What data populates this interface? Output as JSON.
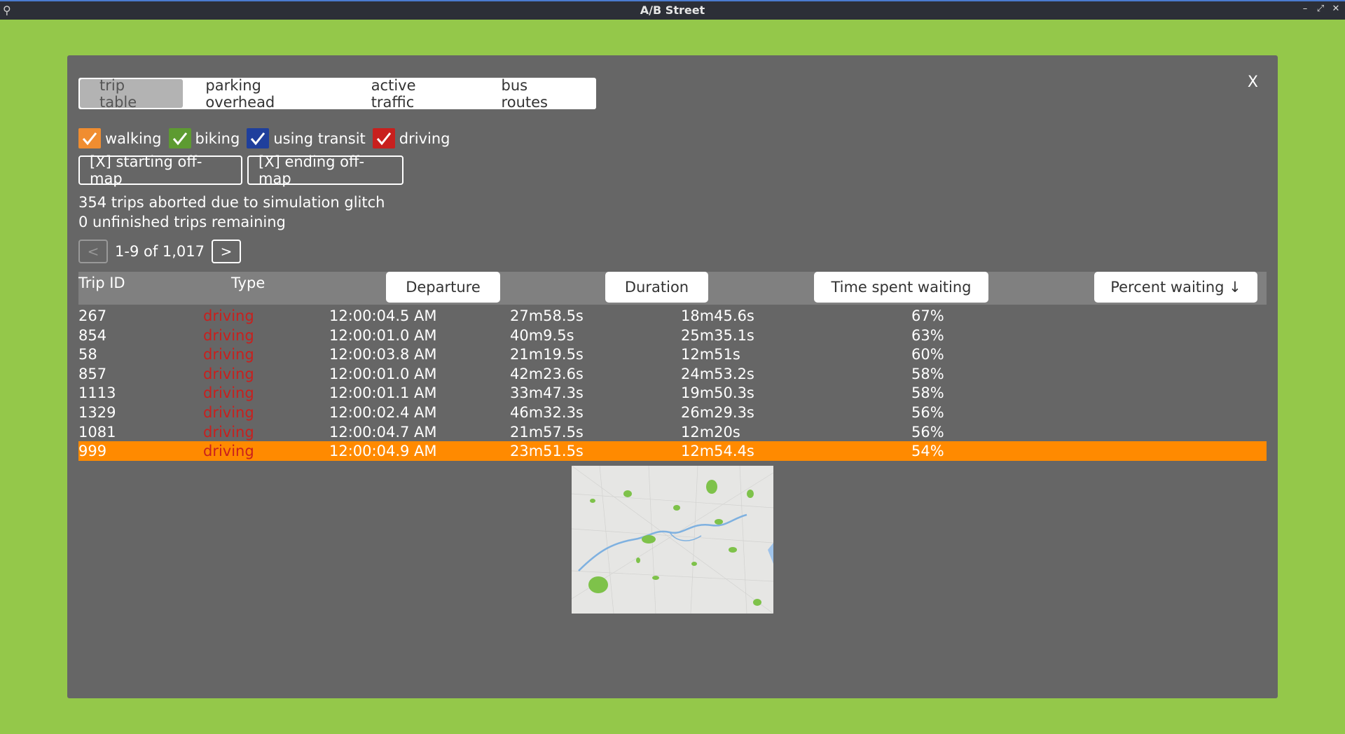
{
  "window": {
    "title": "A/B Street",
    "minimize_glyph": "–",
    "maximize_glyph": "⤢",
    "close_glyph": "✕",
    "app_icon": "bike-icon"
  },
  "panel": {
    "close_label": "X"
  },
  "tabs": [
    {
      "label": "trip table",
      "active": true
    },
    {
      "label": "parking overhead",
      "active": false
    },
    {
      "label": "active traffic",
      "active": false
    },
    {
      "label": "bus routes",
      "active": false
    }
  ],
  "filters": [
    {
      "label": "walking",
      "checked": true,
      "color": "#f08d30"
    },
    {
      "label": "biking",
      "checked": true,
      "color": "#5d9b31"
    },
    {
      "label": "using transit",
      "checked": true,
      "color": "#1f3f9c"
    },
    {
      "label": "driving",
      "checked": true,
      "color": "#c8201e"
    }
  ],
  "buttons": {
    "starting_offmap": "[X] starting off-map",
    "ending_offmap": "[X] ending off-map"
  },
  "status": {
    "aborted": "354 trips aborted due to simulation glitch",
    "unfinished": "0 unfinished trips remaining"
  },
  "pagination": {
    "prev": "<",
    "range": "1-9 of 1,017",
    "next": ">"
  },
  "table": {
    "columns": [
      "Trip ID",
      "Type",
      "Departure",
      "Duration",
      "Time spent waiting",
      "Percent waiting ↓"
    ],
    "rows": [
      [
        "267",
        "driving",
        "12:00:04.5 AM",
        "27m58.5s",
        "18m45.6s",
        "67%"
      ],
      [
        "854",
        "driving",
        "12:00:01.0 AM",
        "40m9.5s",
        "25m35.1s",
        "63%"
      ],
      [
        "58",
        "driving",
        "12:00:03.8 AM",
        "21m19.5s",
        "12m51s",
        "60%"
      ],
      [
        "857",
        "driving",
        "12:00:01.0 AM",
        "42m23.6s",
        "24m53.2s",
        "58%"
      ],
      [
        "1113",
        "driving",
        "12:00:01.1 AM",
        "33m47.3s",
        "19m50.3s",
        "58%"
      ],
      [
        "1329",
        "driving",
        "12:00:02.4 AM",
        "46m32.3s",
        "26m29.3s",
        "56%"
      ],
      [
        "1081",
        "driving",
        "12:00:04.7 AM",
        "21m57.5s",
        "12m20s",
        "56%"
      ],
      [
        "999",
        "driving",
        "12:00:04.9 AM",
        "23m51.5s",
        "12m54.4s",
        "54%"
      ]
    ],
    "selected_row": 7
  },
  "colors": {
    "background": "#94c84a",
    "panel": "#666666",
    "selected_row": "#ff8a00",
    "type_text": "#c8201e"
  }
}
